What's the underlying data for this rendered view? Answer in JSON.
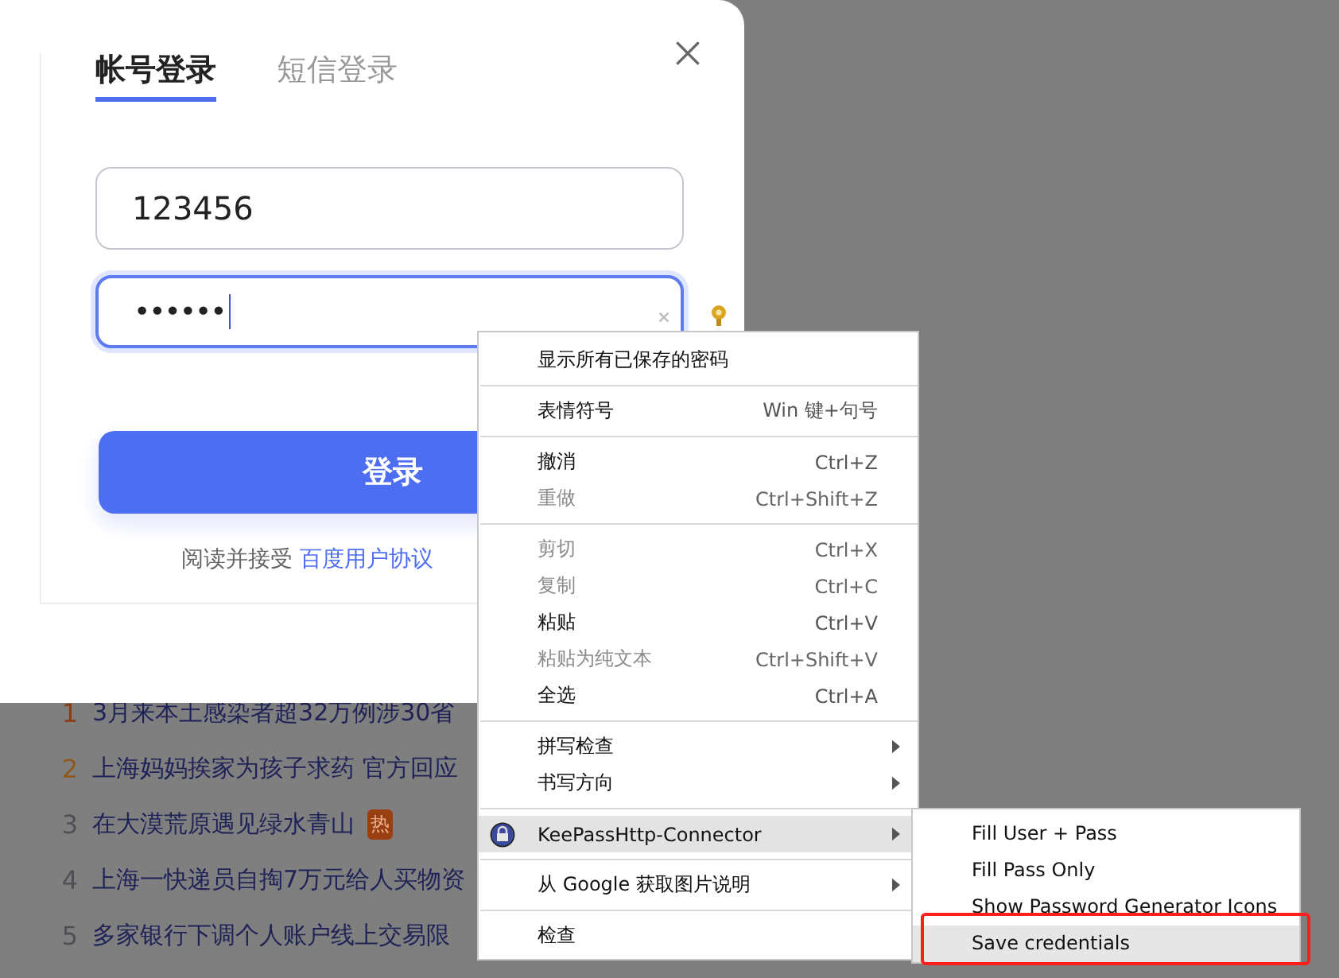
{
  "login_dialog": {
    "tabs": [
      {
        "label": "帐号登录",
        "selected": true
      },
      {
        "label": "短信登录",
        "selected": false
      }
    ],
    "username_field": {
      "value": "123456"
    },
    "password_field": {
      "value": "••••••",
      "focused": true
    },
    "login_button": {
      "label": "登录"
    },
    "agreement": {
      "text": "阅读并接受 ",
      "link": "百度用户协议"
    }
  },
  "hot_list": [
    {
      "rank": "1",
      "title": "3月来本土感染者超32万例涉30省",
      "color": "#8a3c14"
    },
    {
      "rank": "2",
      "title": "上海妈妈挨家为孩子求药 官方回应",
      "color": "#8c5a1c"
    },
    {
      "rank": "3",
      "title": "在大漠荒原遇见绿水青山",
      "color": "#4f4f55",
      "badge": "热"
    },
    {
      "rank": "4",
      "title": "上海一快递员自掏7万元给人买物资",
      "color": "#4f4f55"
    },
    {
      "rank": "5",
      "title": "多家银行下调个人账户线上交易限",
      "color": "#4f4f55"
    }
  ],
  "context_menu": {
    "sections": [
      [
        {
          "label": "显示所有已保存的密码",
          "disabled": false,
          "selected": false,
          "submenu": false
        }
      ],
      [
        {
          "label": "表情符号",
          "shortcut": "Win 键+句号",
          "disabled": false,
          "selected": false,
          "submenu": false
        }
      ],
      [
        {
          "label": "撤消",
          "shortcut": "Ctrl+Z",
          "disabled": false,
          "selected": false,
          "submenu": false
        },
        {
          "label": "重做",
          "shortcut": "Ctrl+Shift+Z",
          "disabled": true,
          "selected": false,
          "submenu": false
        }
      ],
      [
        {
          "label": "剪切",
          "shortcut": "Ctrl+X",
          "disabled": true,
          "selected": false,
          "submenu": false
        },
        {
          "label": "复制",
          "shortcut": "Ctrl+C",
          "disabled": true,
          "selected": false,
          "submenu": false
        },
        {
          "label": "粘贴",
          "shortcut": "Ctrl+V",
          "disabled": false,
          "selected": false,
          "submenu": false
        },
        {
          "label": "粘贴为纯文本",
          "shortcut": "Ctrl+Shift+V",
          "disabled": true,
          "selected": false,
          "submenu": false
        },
        {
          "label": "全选",
          "shortcut": "Ctrl+A",
          "disabled": false,
          "selected": false,
          "submenu": false
        }
      ],
      [
        {
          "label": "拼写检查",
          "disabled": false,
          "selected": false,
          "submenu": true
        },
        {
          "label": "书写方向",
          "disabled": false,
          "selected": false,
          "submenu": true
        }
      ],
      [
        {
          "label": "KeePassHttp-Connector",
          "disabled": false,
          "selected": true,
          "submenu": true,
          "kind": "extension"
        }
      ],
      [
        {
          "label": "从 Google 获取图片说明",
          "disabled": false,
          "selected": false,
          "submenu": true
        }
      ],
      [
        {
          "label": "检查",
          "disabled": false,
          "selected": false,
          "submenu": false
        }
      ]
    ]
  },
  "submenu": {
    "items": [
      {
        "label": "Fill User + Pass",
        "selected": false,
        "highlighted": false
      },
      {
        "label": "Fill Pass Only",
        "selected": false,
        "highlighted": false
      },
      {
        "label": "Show Password Generator Icons",
        "selected": false,
        "highlighted": false
      },
      {
        "label": "Save credentials",
        "selected": true,
        "highlighted": true
      }
    ]
  }
}
